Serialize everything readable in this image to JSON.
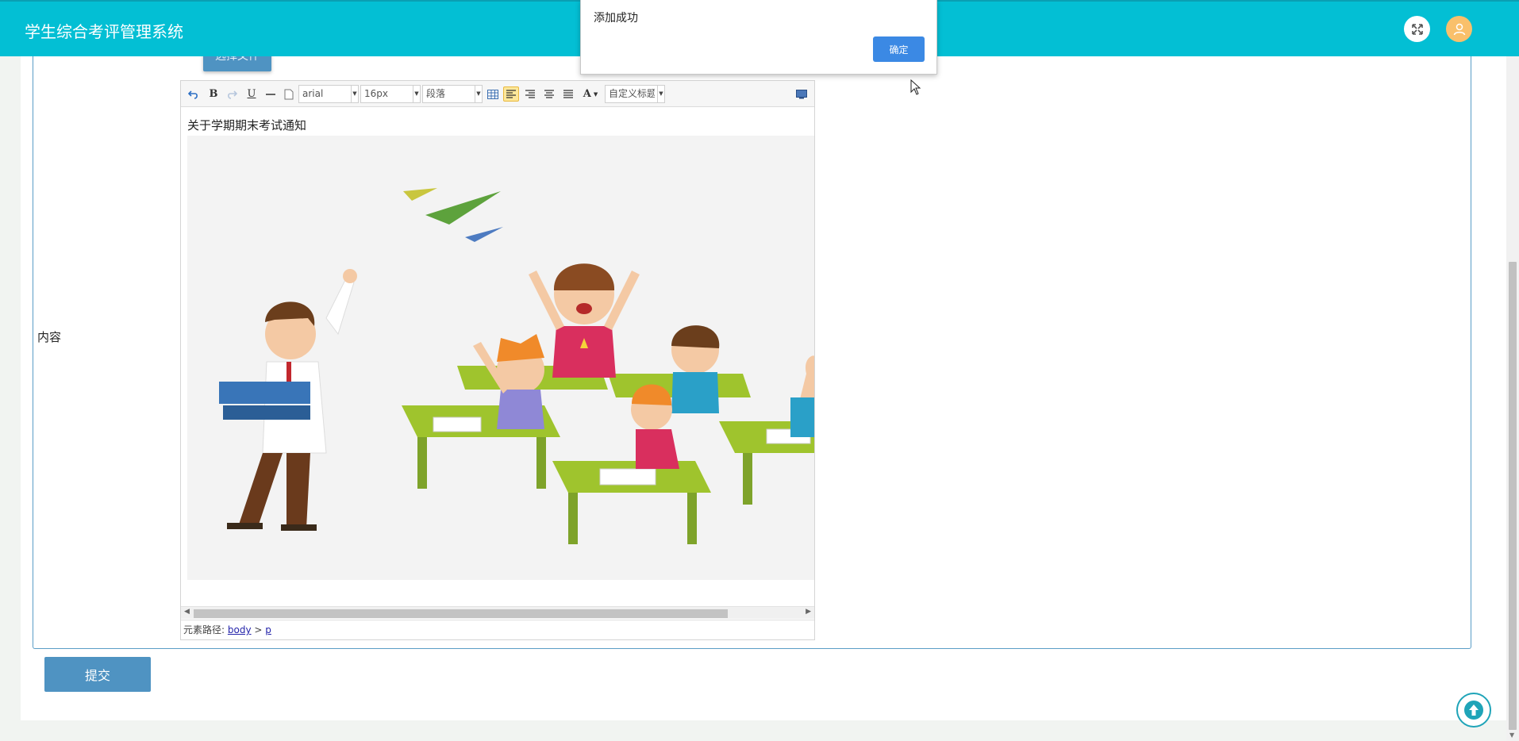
{
  "header": {
    "title": "学生综合考评管理系统",
    "fullscreen_icon": "expand-icon",
    "avatar_icon": "user-icon"
  },
  "form": {
    "content_label": "内容",
    "choose_file_label": "选择文件",
    "submit_label": "提交"
  },
  "editor": {
    "toolbar": {
      "font_family": "arial",
      "font_size": "16px",
      "paragraph_format": "段落",
      "custom_title": "自定义标题",
      "font_color_glyph": "A"
    },
    "paragraph": "关于学期期末考试通知",
    "image_description_icon": "classroom-illustration",
    "path_label": "元素路径:",
    "path_body": "body",
    "path_sep": ">",
    "path_p": "p"
  },
  "alert": {
    "message": "添加成功",
    "ok_label": "确定"
  },
  "colors": {
    "header": "#03bfd4",
    "primary_button": "#4f93c2",
    "alert_ok": "#3b89e4",
    "avatar": "#f9c06b"
  }
}
